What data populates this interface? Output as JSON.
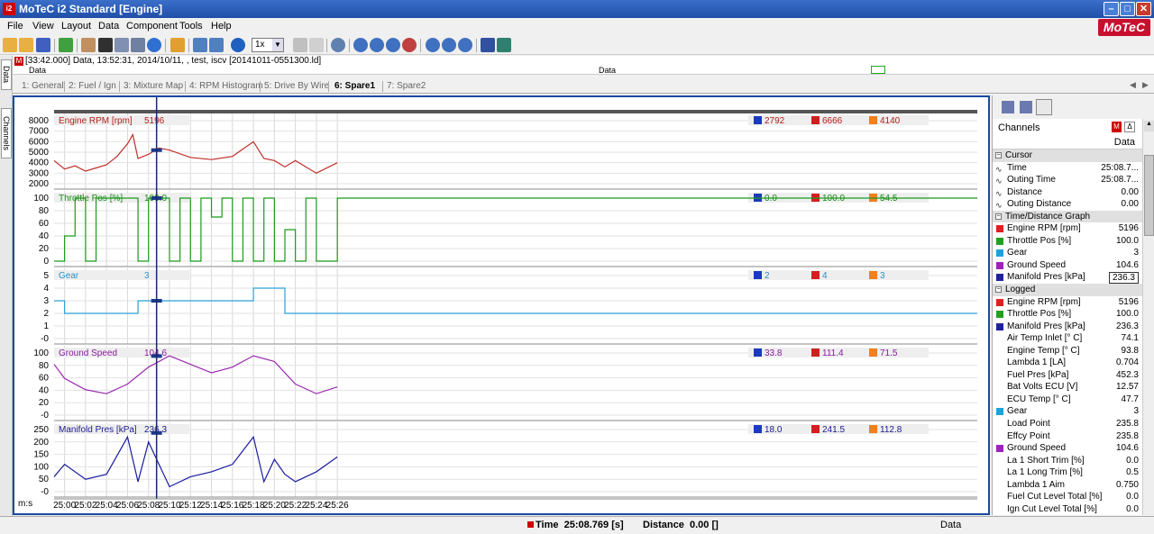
{
  "window": {
    "title": "MoTeC i2 Standard [Engine]",
    "app_icon_text": "i2"
  },
  "menu": [
    "File",
    "View",
    "Layout",
    "Data",
    "Component",
    "Tools",
    "Help"
  ],
  "logo": "MoTeC",
  "toolbar": {
    "zoom": "1x"
  },
  "sidebar_tabs": [
    "Data",
    "Channels"
  ],
  "infobar": {
    "text": "[33:42.000] Data, 13:52:31, 2014/10/11, , test, iscv [20141011-0551300.ld]"
  },
  "databar": {
    "left": "Data",
    "center": "Data"
  },
  "tabs": [
    "1: General",
    "2: Fuel / Ign",
    "3: Mixture Map",
    "4: RPM Histogram",
    "5: Drive By Wire",
    "6: Spare1",
    "7: Spare2"
  ],
  "active_tab": 5,
  "graph": {
    "x_axis_label": "m:s",
    "x_ticks": [
      "25:00",
      "25:02",
      "25:04",
      "25:06",
      "25:08",
      "25:10",
      "25:12",
      "25:14",
      "25:16",
      "25:18",
      "25:20",
      "25:22",
      "25:24",
      "25:26"
    ],
    "panes": [
      {
        "name": "Engine RPM [rpm]",
        "value": "5196",
        "min": "2792",
        "max": "6666",
        "avg": "4140",
        "color": "#c0302a",
        "label_color": "#b0201a",
        "y_ticks": [
          "8000",
          "7000",
          "6000",
          "5000",
          "4000",
          "3000",
          "2000"
        ],
        "y_min": 2000,
        "y_max": 8000
      },
      {
        "name": "Throttle Pos [%]",
        "value": "100.0",
        "min": "0.0",
        "max": "100.0",
        "avg": "54.5",
        "color": "#1a9a1a",
        "label_color": "#1a8a1a",
        "y_ticks": [
          "100",
          "80",
          "60",
          "40",
          "20",
          "0"
        ],
        "y_min": 0,
        "y_max": 100
      },
      {
        "name": "Gear",
        "value": "3",
        "min": "2",
        "max": "4",
        "avg": "3",
        "color": "#2aa0d8",
        "label_color": "#2a90c8",
        "y_ticks": [
          "5",
          "4",
          "3",
          "2",
          "1",
          "-0"
        ],
        "y_min": 0,
        "y_max": 5
      },
      {
        "name": "Ground Speed",
        "value": "104.6",
        "min": "33.8",
        "max": "111.4",
        "avg": "71.5",
        "color": "#9a2ab0",
        "label_color": "#8a1aa0",
        "y_ticks": [
          "100",
          "80",
          "60",
          "40",
          "20",
          "-0"
        ],
        "y_min": 0,
        "y_max": 110
      },
      {
        "name": "Manifold Pres [kPa]",
        "value": "236.3",
        "min": "18.0",
        "max": "241.5",
        "avg": "112.8",
        "color": "#1a1aa0",
        "label_color": "#1a1a90",
        "y_ticks": [
          "250",
          "200",
          "150",
          "100",
          "50",
          "-0"
        ],
        "y_min": 0,
        "y_max": 250
      }
    ]
  },
  "chart_data": [
    {
      "type": "line",
      "title": "Engine RPM [rpm]",
      "x_unit": "m:s",
      "x": [
        "24:59",
        "25:00",
        "25:01",
        "25:02",
        "25:03",
        "25:04",
        "25:05",
        "25:06",
        "25:06.5",
        "25:07",
        "25:08",
        "25:09",
        "25:10",
        "25:12",
        "25:14",
        "25:16",
        "25:17",
        "25:18",
        "25:19",
        "25:20",
        "25:21",
        "25:22",
        "25:24",
        "25:26"
      ],
      "y": [
        4200,
        3400,
        3700,
        3200,
        3500,
        3800,
        4600,
        5800,
        6666,
        4400,
        4800,
        5400,
        5200,
        4500,
        4300,
        4600,
        5300,
        6000,
        4400,
        4200,
        3600,
        4200,
        3000,
        4000
      ],
      "ylim": [
        2000,
        8000
      ]
    },
    {
      "type": "line",
      "title": "Throttle Pos [%]",
      "x_unit": "m:s",
      "x": [
        "24:59",
        "25:00",
        "25:01",
        "25:02",
        "25:03",
        "25:04",
        "25:07",
        "25:08",
        "25:10",
        "25:11",
        "25:12",
        "25:13",
        "25:14",
        "25:15",
        "25:16",
        "25:17",
        "25:18",
        "25:19",
        "25:20",
        "25:21",
        "25:22",
        "25:23",
        "25:24",
        "25:26"
      ],
      "y": [
        0,
        40,
        100,
        0,
        100,
        100,
        0,
        100,
        0,
        100,
        0,
        100,
        70,
        100,
        0,
        100,
        0,
        100,
        0,
        50,
        0,
        100,
        0,
        100
      ],
      "ylim": [
        0,
        100
      ]
    },
    {
      "type": "line",
      "title": "Gear",
      "x_unit": "m:s",
      "x": [
        "24:59",
        "25:00",
        "25:07",
        "25:18",
        "25:21",
        "25:26"
      ],
      "y": [
        3,
        2,
        3,
        4,
        2,
        2
      ],
      "ylim": [
        0,
        5
      ]
    },
    {
      "type": "line",
      "title": "Ground Speed",
      "x_unit": "m:s",
      "x": [
        "24:59",
        "25:00",
        "25:02",
        "25:04",
        "25:06",
        "25:08",
        "25:10",
        "25:12",
        "25:14",
        "25:16",
        "25:18",
        "25:20",
        "25:22",
        "25:24",
        "25:26"
      ],
      "y": [
        90,
        65,
        45,
        38,
        55,
        85,
        105,
        90,
        75,
        85,
        105,
        95,
        55,
        38,
        50
      ],
      "ylim": [
        0,
        110
      ]
    },
    {
      "type": "line",
      "title": "Manifold Pres [kPa]",
      "x_unit": "m:s",
      "x": [
        "24:59",
        "25:00",
        "25:02",
        "25:04",
        "25:06",
        "25:07",
        "25:08",
        "25:10",
        "25:12",
        "25:14",
        "25:16",
        "25:18",
        "25:19",
        "25:20",
        "25:21",
        "25:22",
        "25:24",
        "25:26"
      ],
      "y": [
        60,
        110,
        50,
        70,
        220,
        40,
        200,
        20,
        60,
        80,
        110,
        220,
        40,
        130,
        70,
        40,
        80,
        140
      ],
      "ylim": [
        0,
        250
      ]
    }
  ],
  "right_panel": {
    "header": "Channels",
    "data_label": "Data",
    "rows": [
      {
        "kind": "group",
        "name": "Cursor",
        "value": ""
      },
      {
        "kind": "wave",
        "name": "Time",
        "value": "25:08.7..."
      },
      {
        "kind": "wave",
        "name": "Outing Time",
        "value": "25:08.7..."
      },
      {
        "kind": "wave",
        "name": "Distance",
        "value": "0.00"
      },
      {
        "kind": "wave",
        "name": "Outing Distance",
        "value": "0.00"
      },
      {
        "kind": "group",
        "name": "Time/Distance Graph",
        "value": ""
      },
      {
        "kind": "ch",
        "name": "Engine RPM [rpm]",
        "value": "5196",
        "color": "#e02020"
      },
      {
        "kind": "ch",
        "name": "Throttle Pos [%]",
        "value": "100.0",
        "color": "#20a020"
      },
      {
        "kind": "ch",
        "name": "Gear",
        "value": "3",
        "color": "#20a0e0"
      },
      {
        "kind": "ch",
        "name": "Ground Speed",
        "value": "104.6",
        "color": "#a020c0"
      },
      {
        "kind": "ch",
        "name": "Manifold Pres [kPa]",
        "value": "236.3",
        "color": "#2020a0"
      },
      {
        "kind": "group",
        "name": "Logged",
        "value": ""
      },
      {
        "kind": "ch",
        "name": "Engine RPM [rpm]",
        "value": "5196",
        "color": "#e02020"
      },
      {
        "kind": "ch",
        "name": "Throttle Pos [%]",
        "value": "100.0",
        "color": "#20a020"
      },
      {
        "kind": "ch",
        "name": "Manifold Pres [kPa]",
        "value": "236.3",
        "color": "#2020a0"
      },
      {
        "kind": "plain",
        "name": "Air Temp Inlet [° C]",
        "value": "74.1"
      },
      {
        "kind": "plain",
        "name": "Engine Temp [° C]",
        "value": "93.8"
      },
      {
        "kind": "plain",
        "name": "Lambda 1 [LA]",
        "value": "0.704"
      },
      {
        "kind": "plain",
        "name": "Fuel Pres [kPa]",
        "value": "452.3"
      },
      {
        "kind": "plain",
        "name": "Bat Volts ECU [V]",
        "value": "12.57"
      },
      {
        "kind": "plain",
        "name": "ECU Temp [° C]",
        "value": "47.7"
      },
      {
        "kind": "ch",
        "name": "Gear",
        "value": "3",
        "color": "#20a0e0"
      },
      {
        "kind": "plain",
        "name": "Load Point",
        "value": "235.8"
      },
      {
        "kind": "plain",
        "name": "Effcy Point",
        "value": "235.8"
      },
      {
        "kind": "ch",
        "name": "Ground Speed",
        "value": "104.6",
        "color": "#a020c0"
      },
      {
        "kind": "plain",
        "name": "La 1 Short Trim [%]",
        "value": "0.0"
      },
      {
        "kind": "plain",
        "name": "La 1 Long Trim [%]",
        "value": "0.5"
      },
      {
        "kind": "plain",
        "name": "Lambda 1 Aim",
        "value": "0.750"
      },
      {
        "kind": "plain",
        "name": "Fuel Cut Level Total [%]",
        "value": "0.0"
      },
      {
        "kind": "plain",
        "name": "Ign Cut Level Total [%]",
        "value": "0.0"
      }
    ]
  },
  "statusbar": {
    "time_label": "Time",
    "time_value": "25:08.769 [s]",
    "distance_label": "Distance",
    "distance_value": "0.00 []",
    "right_label": "Data"
  }
}
